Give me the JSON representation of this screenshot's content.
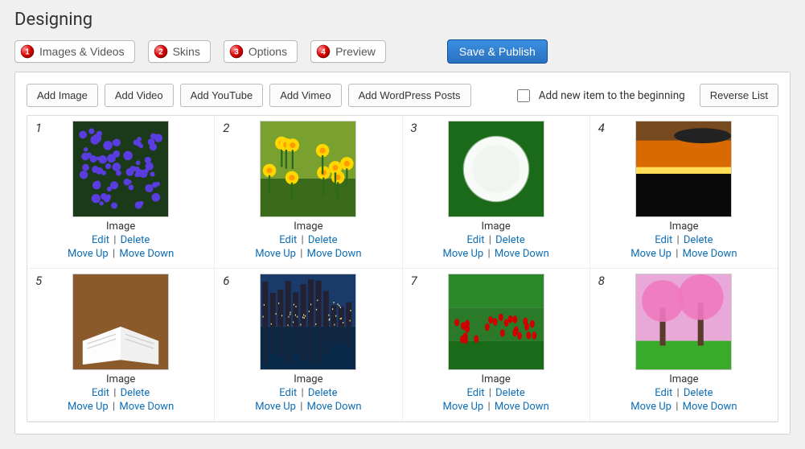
{
  "page_title": "Designing",
  "tabs": [
    {
      "num": "1",
      "label": "Images & Videos"
    },
    {
      "num": "2",
      "label": "Skins"
    },
    {
      "num": "3",
      "label": "Options"
    },
    {
      "num": "4",
      "label": "Preview"
    }
  ],
  "save_label": "Save & Publish",
  "toolbar": {
    "add_image": "Add Image",
    "add_video": "Add Video",
    "add_youtube": "Add YouTube",
    "add_vimeo": "Add Vimeo",
    "add_posts": "Add WordPress Posts",
    "add_beginning": "Add new item to the beginning",
    "reverse_list": "Reverse List"
  },
  "item_labels": {
    "type": "Image",
    "edit": "Edit",
    "delete": "Delete",
    "move_up": "Move Up",
    "move_down": "Move Down"
  },
  "items": [
    {
      "idx": "1",
      "img": "hyacinth"
    },
    {
      "idx": "2",
      "img": "daffodil"
    },
    {
      "idx": "3",
      "img": "dandelion"
    },
    {
      "idx": "4",
      "img": "sunset"
    },
    {
      "idx": "5",
      "img": "book"
    },
    {
      "idx": "6",
      "img": "skyline"
    },
    {
      "idx": "7",
      "img": "tulips"
    },
    {
      "idx": "8",
      "img": "cherry"
    }
  ]
}
